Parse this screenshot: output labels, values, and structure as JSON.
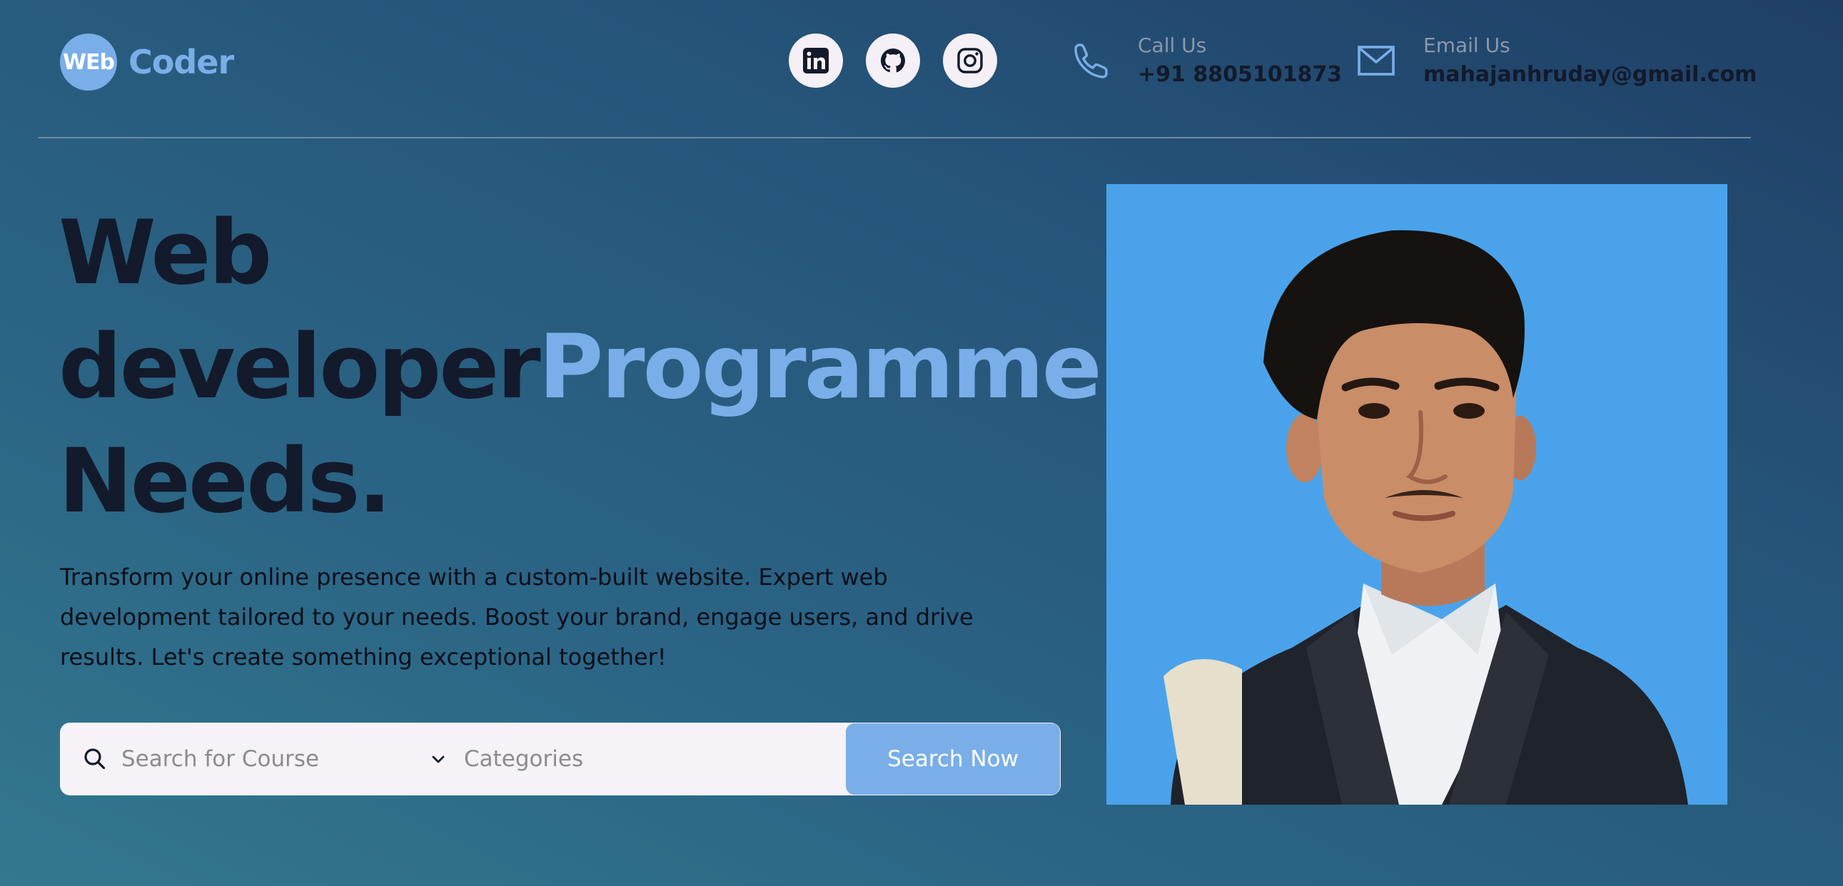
{
  "header": {
    "logo_badge": "WEb",
    "logo_text": "Coder",
    "social": [
      {
        "name": "linkedin-icon"
      },
      {
        "name": "github-icon"
      },
      {
        "name": "instagram-icon"
      }
    ],
    "call": {
      "label": "Call Us",
      "value": "+91 8805101873",
      "icon": "phone-icon"
    },
    "email": {
      "label": "Email Us",
      "value": "mahajanhruday@gmail.com",
      "icon": "mail-icon"
    }
  },
  "hero": {
    "headline_line1": "Web",
    "headline_line2a": "developer",
    "headline_line2b": "Programmer",
    "headline_line3": "Needs.",
    "description": "Transform your online presence with a custom-built website. Expert web development tailored to your needs. Boost your brand, engage users, and drive results. Let's create something exceptional together!"
  },
  "search": {
    "placeholder": "Search for Course",
    "category_value": "Categories",
    "button_label": "Search Now"
  },
  "colors": {
    "accent": "#7aaee8",
    "dark_text": "#131a2b",
    "portrait_bg": "#4aa3ea"
  }
}
